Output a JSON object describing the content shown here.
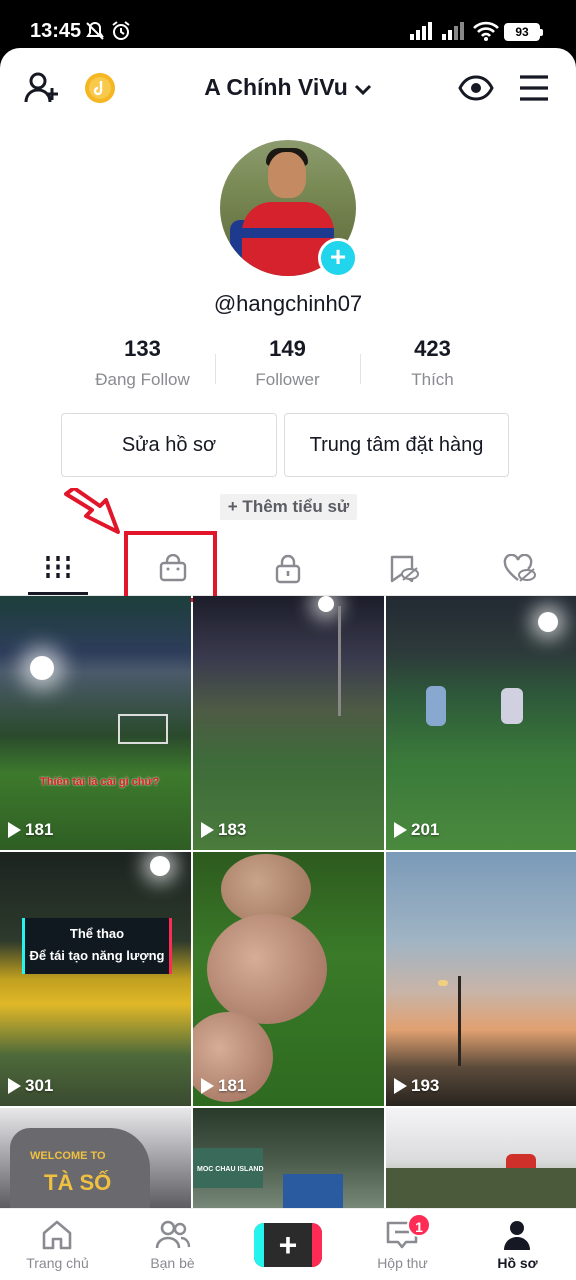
{
  "status_bar": {
    "time": "13:45",
    "battery": "93"
  },
  "header": {
    "title": "A Chính ViVu"
  },
  "profile": {
    "handle": "@hangchinh07",
    "stats": [
      {
        "value": "133",
        "label": "Đang Follow"
      },
      {
        "value": "149",
        "label": "Follower"
      },
      {
        "value": "423",
        "label": "Thích"
      }
    ],
    "edit_button": "Sửa hồ sơ",
    "orders_button": "Trung tâm đặt hàng",
    "add_bio": "+ Thêm tiểu sử"
  },
  "tabs": [
    {
      "icon": "grid-icon"
    },
    {
      "icon": "shopping-bag-icon"
    },
    {
      "icon": "lock-icon"
    },
    {
      "icon": "bookmark-hidden-icon"
    },
    {
      "icon": "heart-hidden-icon"
    }
  ],
  "videos": [
    {
      "views": "181",
      "overlay": "Thiên tài là cái gì chứ?"
    },
    {
      "views": "183"
    },
    {
      "views": "201"
    },
    {
      "views": "301",
      "overlay_title": "Thể thao",
      "overlay_sub": "Để tái tạo năng lượng"
    },
    {
      "views": "181"
    },
    {
      "views": "193"
    },
    {
      "overlay": "WELCOME TO",
      "overlay2": "TÀ SỐ"
    },
    {
      "overlay": "MOC CHAU ISLAND"
    },
    {}
  ],
  "bottom_nav": {
    "items": [
      "Trang chủ",
      "Bạn bè",
      "",
      "Hộp thư",
      "Hồ sơ"
    ],
    "inbox_badge": "1"
  },
  "colors": {
    "accent": "#fe2c55",
    "cyan": "#20d5ec",
    "annotation": "#e2162b"
  }
}
